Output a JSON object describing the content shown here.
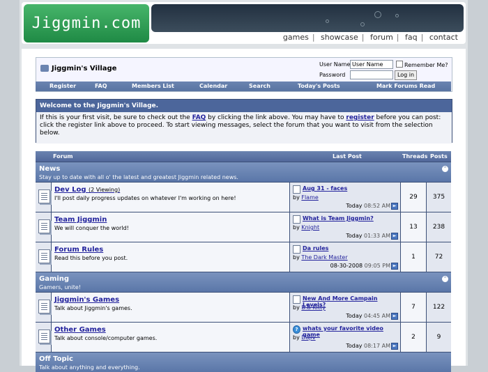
{
  "header": {
    "logo_text": "Jiggmin.com",
    "nav": [
      "games",
      "showcase",
      "forum",
      "faq",
      "contact"
    ]
  },
  "navbar": {
    "title": "Jiggmin's Village",
    "username_label": "User Name",
    "username_value": "User Name",
    "password_label": "Password",
    "remember_label": "Remember Me?",
    "login_button": "Log in"
  },
  "linkbar": [
    "Register",
    "FAQ",
    "Members List",
    "Calendar",
    "Search",
    "Today's Posts",
    "Mark Forums Read"
  ],
  "welcome": {
    "title": "Welcome to the Jiggmin's Village.",
    "t1": "If this is your first visit, be sure to check out the ",
    "faq": "FAQ",
    "t2": " by clicking the link above. You may have to ",
    "register": "register",
    "t3": " before you can post: click the register link above to proceed. To start viewing messages, select the forum that you want to visit from the selection below."
  },
  "table_headers": {
    "forum": "Forum",
    "last_post": "Last Post",
    "threads": "Threads",
    "posts": "Posts"
  },
  "categories": [
    {
      "name": "News",
      "desc": "Stay up to date with all o' the latest and greatest Jiggmin related news."
    },
    {
      "name": "Gaming",
      "desc": "Gamers, unite!"
    },
    {
      "name": "Off Topic",
      "desc": "Talk about anything and everything."
    }
  ],
  "forums": [
    {
      "name": "Dev Log",
      "viewing": "(2 Viewing)",
      "desc": "I'll post daily progress updates on whatever I'm working on here!",
      "lp_title": "Aug 31 - faces",
      "lp_by": "by",
      "lp_user": "Flame",
      "lp_day": "Today",
      "lp_time": "08:52 AM",
      "threads": "29",
      "posts": "375"
    },
    {
      "name": "Team Jiggmin",
      "viewing": "",
      "desc": "We will conquer the world!",
      "lp_title": "What is Team Jiggmin?",
      "lp_by": "by",
      "lp_user": "Knight",
      "lp_day": "Today",
      "lp_time": "01:33 AM",
      "threads": "13",
      "posts": "238"
    },
    {
      "name": "Forum Rules",
      "viewing": "",
      "desc": "Read this before you post.",
      "lp_title": "Da rules",
      "lp_by": "by",
      "lp_user": "The Dark Master",
      "lp_day": "08-30-2008",
      "lp_time": "09:05 PM",
      "threads": "1",
      "posts": "72"
    },
    {
      "name": "Jiggmin's Games",
      "viewing": "",
      "desc": "Talk about Jiggmin's games.",
      "lp_title": "New And More Campain Levels?",
      "lp_by": "by",
      "lp_user": "B.B Kitty",
      "lp_day": "Today",
      "lp_time": "04:45 AM",
      "threads": "7",
      "posts": "122"
    },
    {
      "name": "Other Games",
      "viewing": "",
      "desc": "Talk about console/computer games.",
      "lp_title": "whats your favorite video game",
      "lp_by": "by",
      "lp_user": "Dajiv",
      "lp_day": "Today",
      "lp_time": "08:17 AM",
      "threads": "2",
      "posts": "9"
    }
  ]
}
